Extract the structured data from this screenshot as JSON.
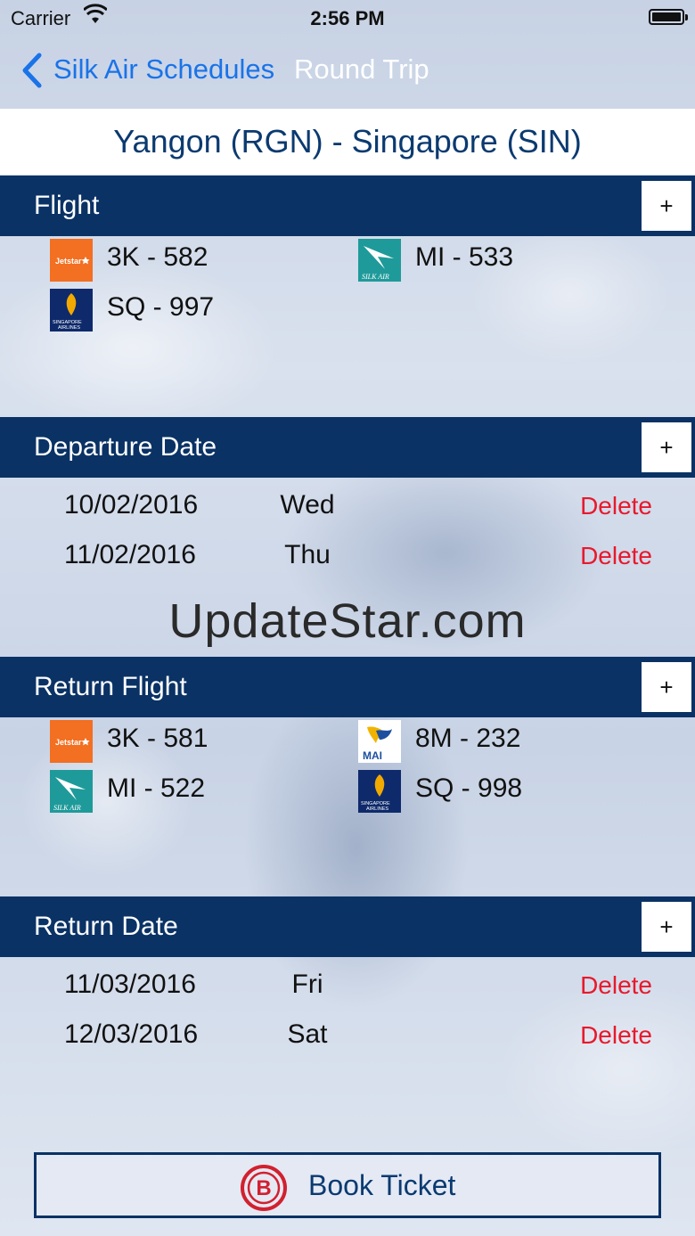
{
  "status": {
    "carrier": "Carrier",
    "time": "2:56 PM"
  },
  "nav": {
    "back_label": "Silk Air Schedules",
    "title": "Round Trip"
  },
  "route": "Yangon (RGN) - Singapore (SIN)",
  "flight": {
    "title": "Flight",
    "add_label": "+",
    "items": [
      {
        "code": "3K - 582",
        "logo": "jetstar-logo"
      },
      {
        "code": "MI - 533",
        "logo": "silkair-logo"
      },
      {
        "code": "SQ - 997",
        "logo": "singapore-airlines-logo"
      }
    ]
  },
  "departure": {
    "title": "Departure Date",
    "add_label": "+",
    "rows": [
      {
        "date": "10/02/2016",
        "day": "Wed",
        "action": "Delete"
      },
      {
        "date": "11/02/2016",
        "day": "Thu",
        "action": "Delete"
      }
    ]
  },
  "watermark": "UpdateStar.com",
  "return_flight": {
    "title": "Return Flight",
    "add_label": "+",
    "items": [
      {
        "code": "3K - 581",
        "logo": "jetstar-logo"
      },
      {
        "code": "8M - 232",
        "logo": "myanmar-airways-logo"
      },
      {
        "code": "MI - 522",
        "logo": "silkair-logo"
      },
      {
        "code": "SQ - 998",
        "logo": "singapore-airlines-logo"
      }
    ]
  },
  "return_date": {
    "title": "Return Date",
    "add_label": "+",
    "rows": [
      {
        "date": "11/03/2016",
        "day": "Fri",
        "action": "Delete"
      },
      {
        "date": "12/03/2016",
        "day": "Sat",
        "action": "Delete"
      }
    ]
  },
  "book": {
    "label": "Book Ticket",
    "icon": "b-circle-icon"
  },
  "colors": {
    "header": "#0a3265",
    "accent_blue": "#1a73e8",
    "delete_red": "#e8192c",
    "route_text": "#0b3a70"
  }
}
